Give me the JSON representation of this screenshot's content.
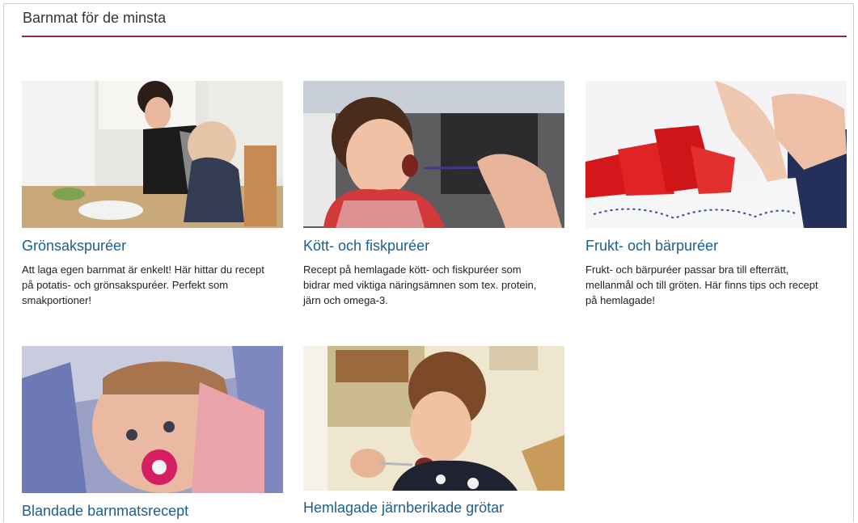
{
  "section": {
    "title": "Barnmat för de minsta"
  },
  "cards": [
    {
      "title": "Grönsakspuréer",
      "description": "Att laga egen barnmat är enkelt! Här hittar du recept på potatis- och grönsakspuréer. Perfekt som smakportioner!",
      "image_icon": "mother-feeding-baby-photo"
    },
    {
      "title": "Kött- och fiskpuréer",
      "description": "Recept på hemlagade kött- och fiskpuréer som bidrar med viktiga näringsämnen som tex. protein, järn och omega-3.",
      "image_icon": "toddler-eating-photo"
    },
    {
      "title": "Frukt- och bärpuréer",
      "description": "Frukt- och bärpuréer passar bra till efterrätt, mellanmål och till gröten. Här finns tips och recept på hemlagade!",
      "image_icon": "strawberries-bowl-photo"
    },
    {
      "title": "Blandade barnmatsrecept",
      "description": "",
      "image_icon": "baby-with-pacifier-photo"
    },
    {
      "title": "Hemlagade järnberikade grötar",
      "description": "",
      "image_icon": "boy-eating-porridge-photo"
    }
  ],
  "colors": {
    "link": "#1f5e8c",
    "accent_rule": "#8e2b3c"
  }
}
